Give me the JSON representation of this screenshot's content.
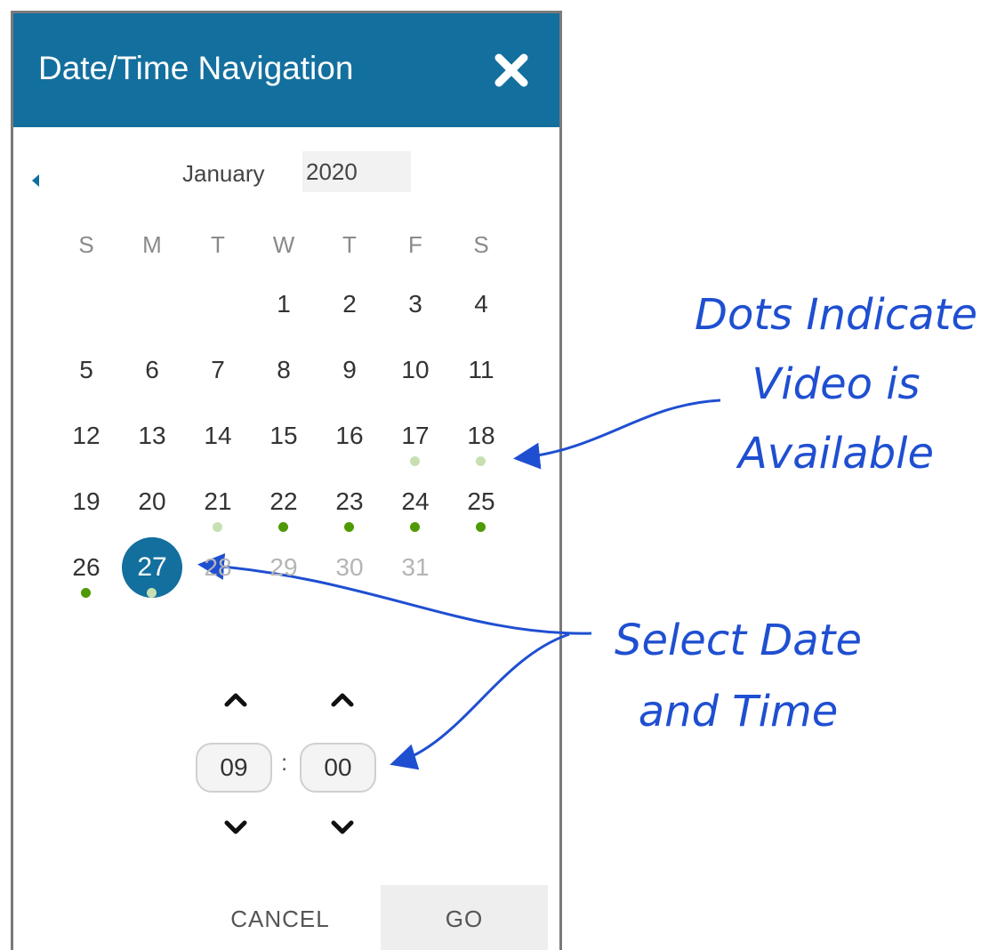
{
  "dialog": {
    "title": "Date/Time Navigation",
    "month": "January",
    "year": "2020",
    "weekdays": [
      "S",
      "M",
      "T",
      "W",
      "T",
      "F",
      "S"
    ],
    "days": [
      {
        "label": "1",
        "col": 3,
        "row": 0
      },
      {
        "label": "2",
        "col": 4,
        "row": 0
      },
      {
        "label": "3",
        "col": 5,
        "row": 0
      },
      {
        "label": "4",
        "col": 6,
        "row": 0
      },
      {
        "label": "5",
        "col": 0,
        "row": 1
      },
      {
        "label": "6",
        "col": 1,
        "row": 1
      },
      {
        "label": "7",
        "col": 2,
        "row": 1
      },
      {
        "label": "8",
        "col": 3,
        "row": 1
      },
      {
        "label": "9",
        "col": 4,
        "row": 1
      },
      {
        "label": "10",
        "col": 5,
        "row": 1
      },
      {
        "label": "11",
        "col": 6,
        "row": 1
      },
      {
        "label": "12",
        "col": 0,
        "row": 2
      },
      {
        "label": "13",
        "col": 1,
        "row": 2
      },
      {
        "label": "14",
        "col": 2,
        "row": 2
      },
      {
        "label": "15",
        "col": 3,
        "row": 2
      },
      {
        "label": "16",
        "col": 4,
        "row": 2
      },
      {
        "label": "17",
        "col": 5,
        "row": 2,
        "dot": "light"
      },
      {
        "label": "18",
        "col": 6,
        "row": 2,
        "dot": "light"
      },
      {
        "label": "19",
        "col": 0,
        "row": 3
      },
      {
        "label": "20",
        "col": 1,
        "row": 3
      },
      {
        "label": "21",
        "col": 2,
        "row": 3,
        "dot": "light"
      },
      {
        "label": "22",
        "col": 3,
        "row": 3,
        "dot": "dark"
      },
      {
        "label": "23",
        "col": 4,
        "row": 3,
        "dot": "dark"
      },
      {
        "label": "24",
        "col": 5,
        "row": 3,
        "dot": "dark"
      },
      {
        "label": "25",
        "col": 6,
        "row": 3,
        "dot": "dark"
      },
      {
        "label": "26",
        "col": 0,
        "row": 4,
        "dot": "dark"
      },
      {
        "label": "27",
        "col": 1,
        "row": 4,
        "dot": "light",
        "selected": true
      },
      {
        "label": "28",
        "col": 2,
        "row": 4,
        "disabled": true
      },
      {
        "label": "29",
        "col": 3,
        "row": 4,
        "disabled": true
      },
      {
        "label": "30",
        "col": 4,
        "row": 4,
        "disabled": true
      },
      {
        "label": "31",
        "col": 5,
        "row": 4,
        "disabled": true
      }
    ],
    "time": {
      "hour": "09",
      "separator": ":",
      "minute": "00"
    },
    "cancel_label": "CANCEL",
    "go_label": "GO"
  },
  "annotations": {
    "dots": [
      "Dots Indicate",
      "Video is",
      "Available"
    ],
    "select": [
      "Select Date",
      "and Time"
    ]
  },
  "colors": {
    "header": "#136f9e",
    "selected": "#136f9e",
    "dot_light": "#c7e0b1",
    "dot_dark": "#4e9a06",
    "annotation": "#1f4fd1"
  },
  "icons": {
    "close": "close-icon",
    "prev": "caret-left-icon",
    "up": "chevron-up-icon",
    "down": "chevron-down-icon"
  }
}
